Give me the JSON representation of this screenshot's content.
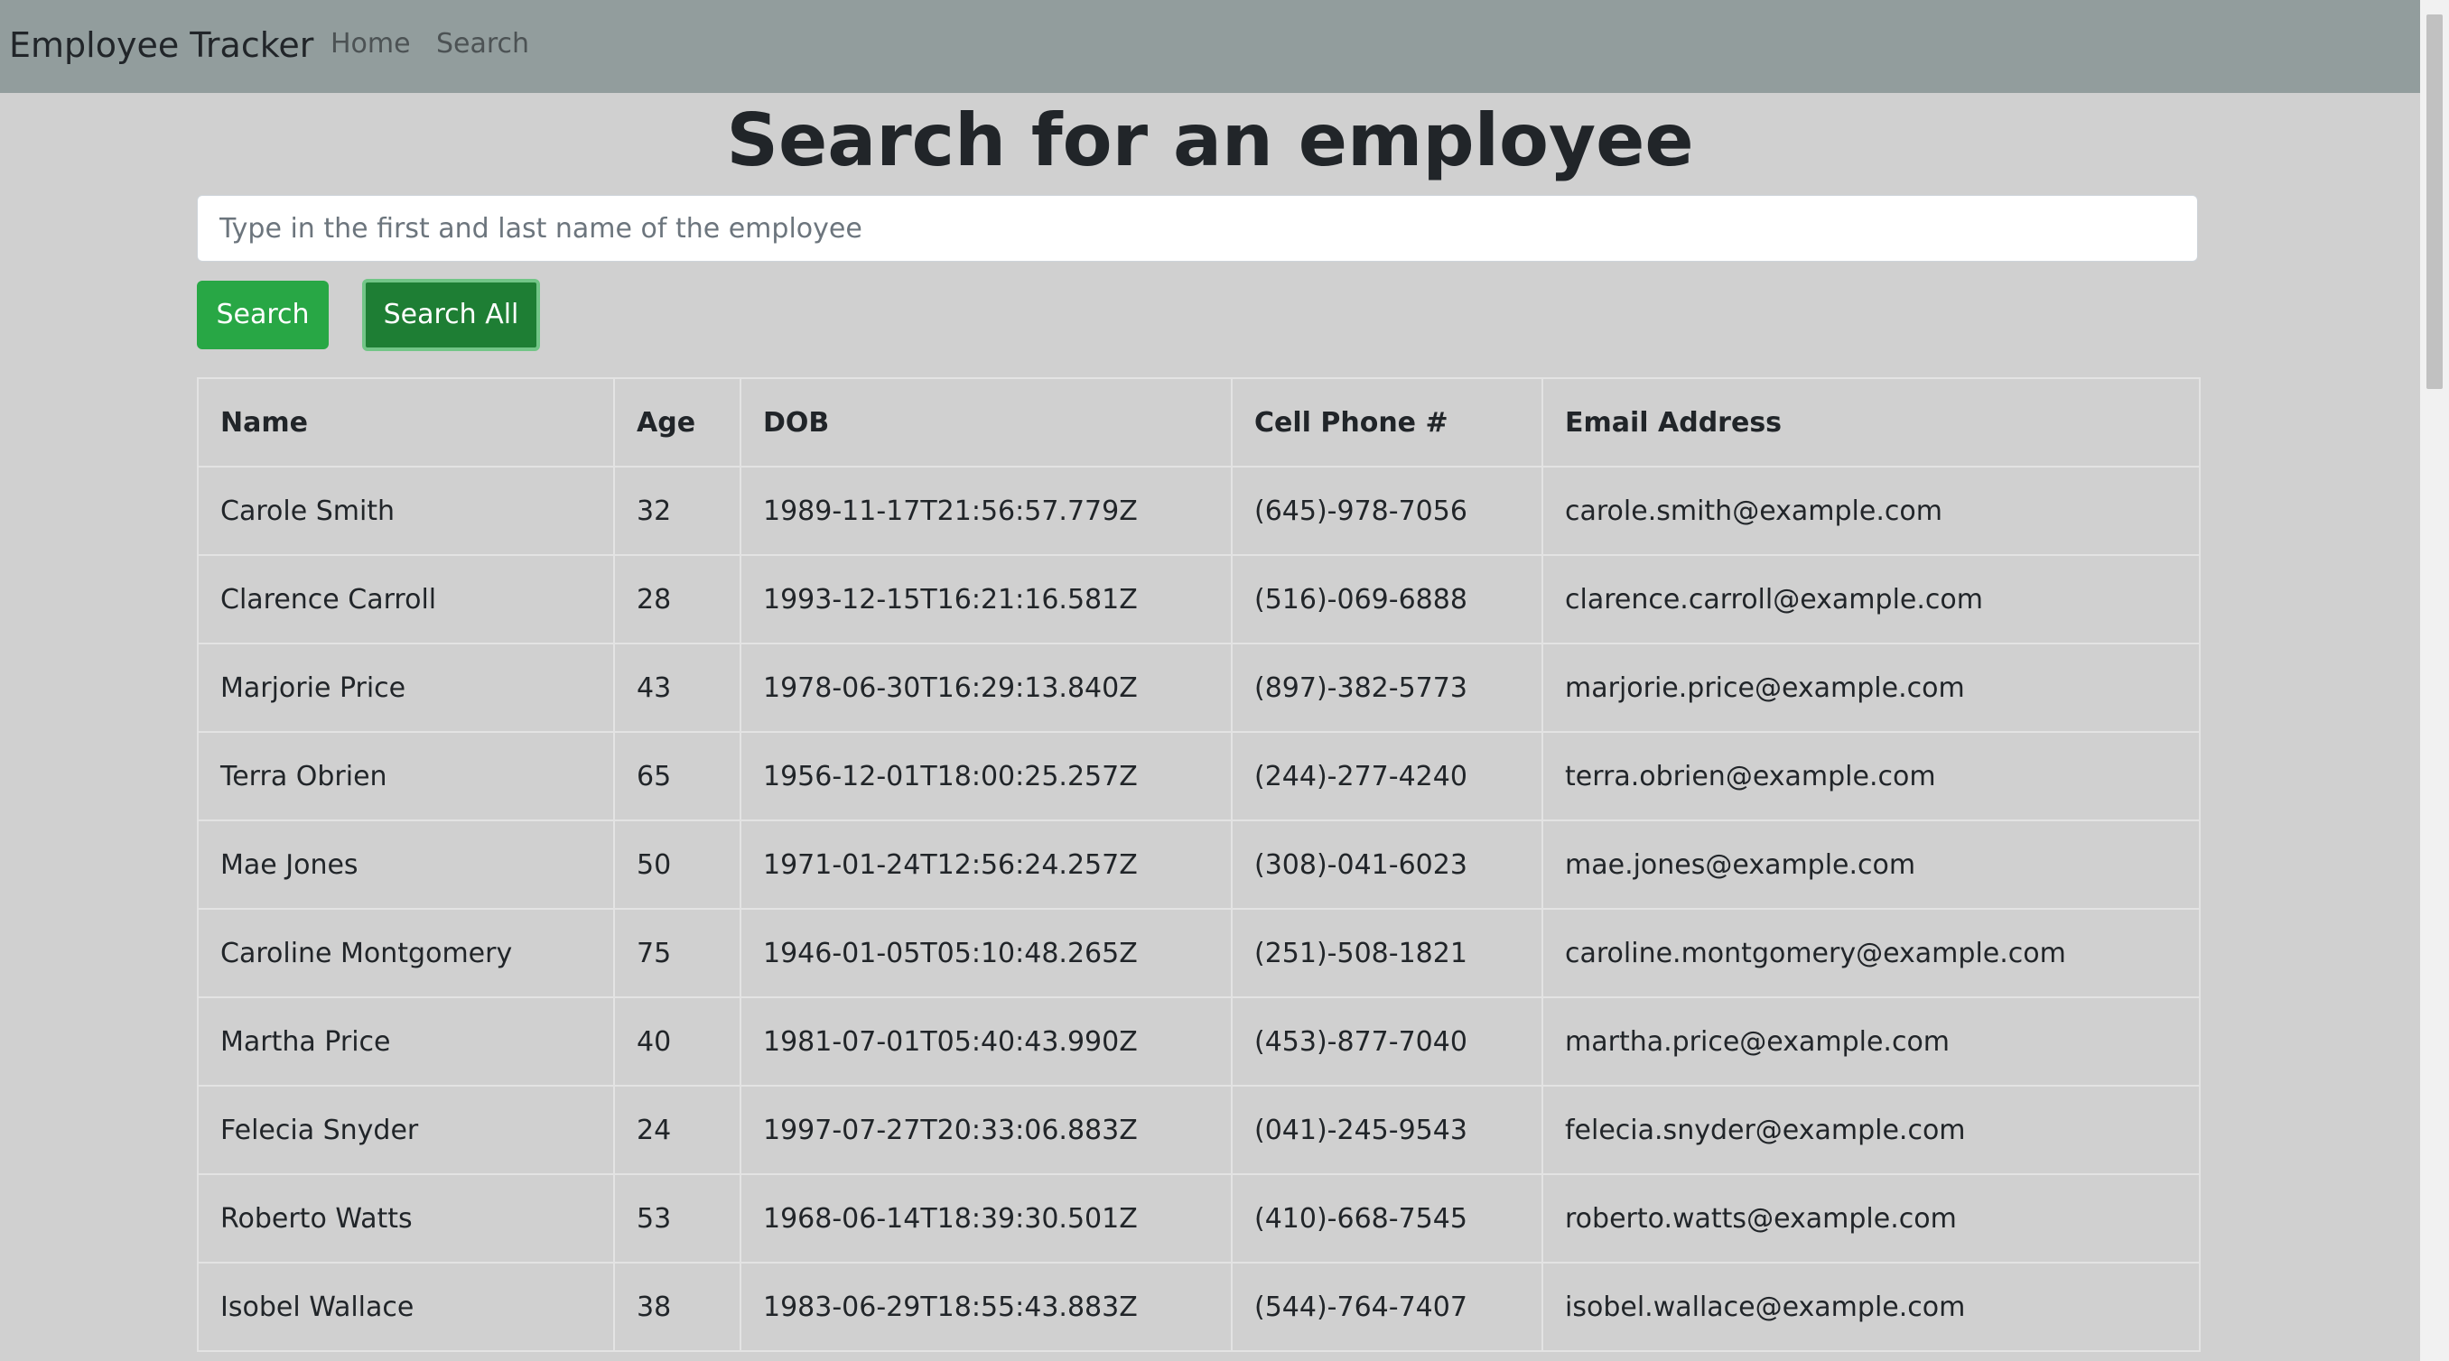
{
  "navbar": {
    "brand": "Employee Tracker",
    "links": [
      "Home",
      "Search"
    ]
  },
  "heading": "Search for an employee",
  "search": {
    "placeholder": "Type in the first and last name of the employee",
    "value": "",
    "search_label": "Search",
    "search_all_label": "Search All"
  },
  "table": {
    "headers": [
      "Name",
      "Age",
      "DOB",
      "Cell Phone #",
      "Email Address"
    ],
    "rows": [
      [
        "Carole Smith",
        "32",
        "1989-11-17T21:56:57.779Z",
        "(645)-978-7056",
        "carole.smith@example.com"
      ],
      [
        "Clarence Carroll",
        "28",
        "1993-12-15T16:21:16.581Z",
        "(516)-069-6888",
        "clarence.carroll@example.com"
      ],
      [
        "Marjorie Price",
        "43",
        "1978-06-30T16:29:13.840Z",
        "(897)-382-5773",
        "marjorie.price@example.com"
      ],
      [
        "Terra Obrien",
        "65",
        "1956-12-01T18:00:25.257Z",
        "(244)-277-4240",
        "terra.obrien@example.com"
      ],
      [
        "Mae Jones",
        "50",
        "1971-01-24T12:56:24.257Z",
        "(308)-041-6023",
        "mae.jones@example.com"
      ],
      [
        "Caroline Montgomery",
        "75",
        "1946-01-05T05:10:48.265Z",
        "(251)-508-1821",
        "caroline.montgomery@example.com"
      ],
      [
        "Martha Price",
        "40",
        "1981-07-01T05:40:43.990Z",
        "(453)-877-7040",
        "martha.price@example.com"
      ],
      [
        "Felecia Snyder",
        "24",
        "1997-07-27T20:33:06.883Z",
        "(041)-245-9543",
        "felecia.snyder@example.com"
      ],
      [
        "Roberto Watts",
        "53",
        "1968-06-14T18:39:30.501Z",
        "(410)-668-7545",
        "roberto.watts@example.com"
      ],
      [
        "Isobel Wallace",
        "38",
        "1983-06-29T18:55:43.883Z",
        "(544)-764-7407",
        "isobel.wallace@example.com"
      ]
    ]
  },
  "colors": {
    "navbar": "#929d9d",
    "background": "#d0d0d0",
    "search_button": "#28a745",
    "search_all_button": "#1e7e34"
  }
}
